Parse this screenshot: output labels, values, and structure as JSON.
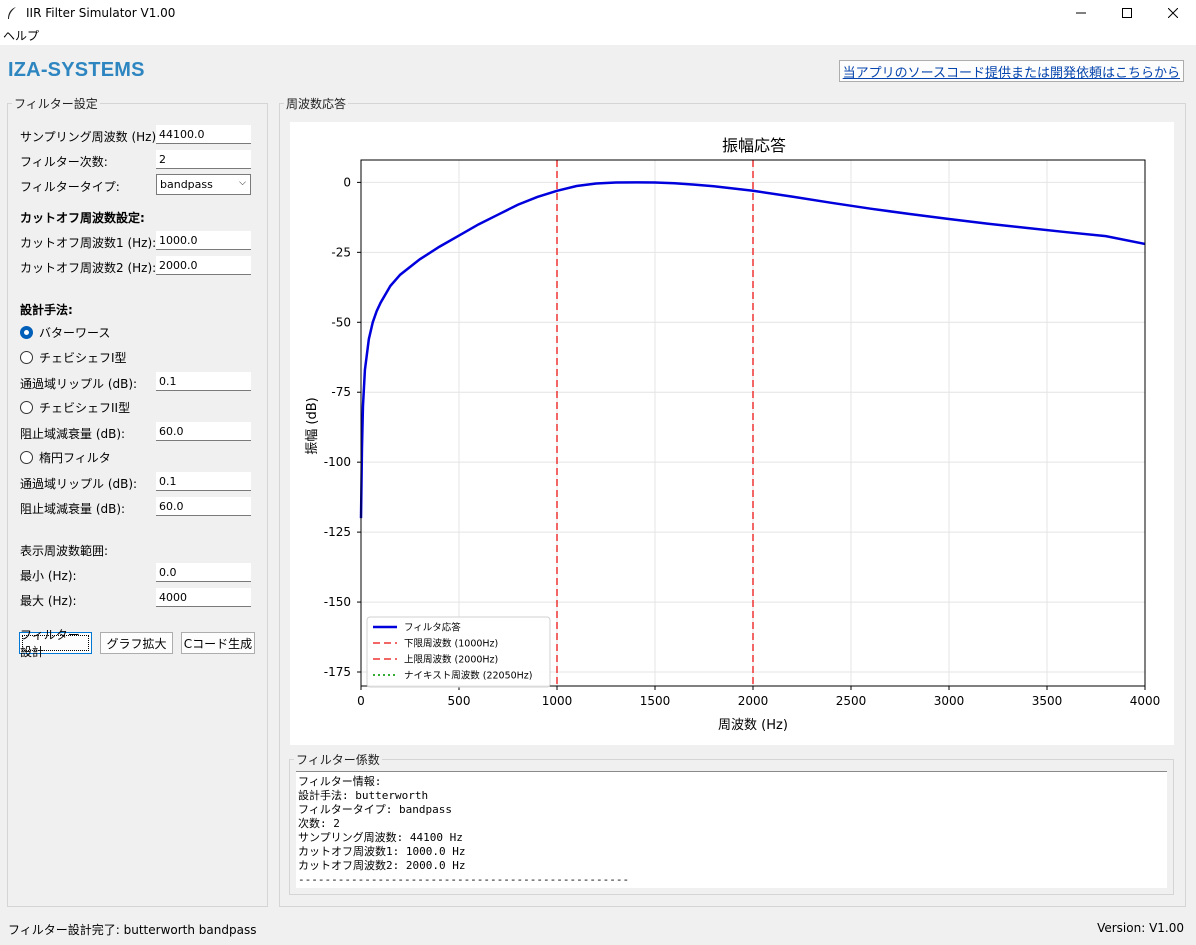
{
  "window": {
    "title": "IIR Filter Simulator V1.00",
    "menu_help": "ヘルプ"
  },
  "header": {
    "brand": "IZA-SYSTEMS",
    "link": "当アプリのソースコード提供または開発依頼はこちらから"
  },
  "settings": {
    "legend": "フィルター設定",
    "sampling_label": "サンプリング周波数 (Hz):",
    "sampling_value": "44100.0",
    "order_label": "フィルター次数:",
    "order_value": "2",
    "type_label": "フィルタータイプ:",
    "type_value": "bandpass",
    "cutoff_heading": "カットオフ周波数設定:",
    "cutoff1_label": "カットオフ周波数1 (Hz):",
    "cutoff1_value": "1000.0",
    "cutoff2_label": "カットオフ周波数2 (Hz):",
    "cutoff2_value": "2000.0",
    "design_heading": "設計手法:",
    "radio_butterworth": "バターワース",
    "radio_cheby1": "チェビシェフI型",
    "ripple1_label": "通過域リップル (dB):",
    "ripple1_value": "0.1",
    "radio_cheby2": "チェビシェフII型",
    "atten1_label": "阻止域減衰量 (dB):",
    "atten1_value": "60.0",
    "radio_elliptic": "楕円フィルタ",
    "ripple2_label": "通過域リップル (dB):",
    "ripple2_value": "0.1",
    "atten2_label": "阻止域減衰量 (dB):",
    "atten2_value": "60.0",
    "range_heading": "表示周波数範囲:",
    "min_label": "最小 (Hz):",
    "min_value": "0.0",
    "max_label": "最大 (Hz):",
    "max_value": "4000",
    "btn_design": "フィルター設計",
    "btn_zoom": "グラフ拡大",
    "btn_ccode": "Cコード生成"
  },
  "response": {
    "legend": "周波数応答"
  },
  "coefficients": {
    "legend": "フィルター係数",
    "lines": [
      "フィルター情報:",
      "設計手法: butterworth",
      "フィルタータイプ: bandpass",
      "次数: 2",
      "サンプリング周波数: 44100 Hz",
      "カットオフ周波数1: 1000.0 Hz",
      "カットオフ周波数2: 2000.0 Hz",
      "--------------------------------------------------"
    ]
  },
  "status": {
    "message": "フィルター設計完了: butterworth bandpass",
    "version": "Version: V1.00"
  },
  "colors": {
    "brand": "#2e86c1",
    "response_line": "#0000dd",
    "cutoff_line": "#ee3333",
    "nyquist_line": "#33aa33"
  },
  "chart_data": {
    "type": "line",
    "title": "振幅応答",
    "xlabel": "周波数 (Hz)",
    "ylabel": "振幅 (dB)",
    "xlim": [
      0,
      4000
    ],
    "ylim": [
      -180,
      8
    ],
    "xticks": [
      0,
      500,
      1000,
      1500,
      2000,
      2500,
      3000,
      3500,
      4000
    ],
    "yticks": [
      0,
      -25,
      -50,
      -75,
      -100,
      -125,
      -150,
      -175
    ],
    "grid": true,
    "legend_position": "lower-left",
    "series": [
      {
        "name": "フィルタ応答",
        "style": "solid",
        "x": [
          0,
          5,
          10,
          20,
          40,
          60,
          80,
          100,
          150,
          200,
          300,
          400,
          500,
          600,
          700,
          800,
          900,
          1000,
          1100,
          1200,
          1300,
          1414,
          1500,
          1600,
          1700,
          1800,
          1900,
          2000,
          2200,
          2400,
          2600,
          2800,
          3000,
          3200,
          3400,
          3600,
          3800,
          4000
        ],
        "y": [
          -120,
          -95,
          -80,
          -67,
          -56,
          -50,
          -46,
          -43,
          -37,
          -33,
          -27.5,
          -23,
          -19,
          -15,
          -11.5,
          -8,
          -5.2,
          -3,
          -1.3,
          -0.4,
          -0.05,
          0,
          -0.05,
          -0.3,
          -0.8,
          -1.4,
          -2.2,
          -3,
          -5.1,
          -7.3,
          -9.4,
          -11.3,
          -13.1,
          -14.8,
          -16.3,
          -17.8,
          -19.2,
          -22
        ]
      },
      {
        "name": "下限周波数 (1000Hz)",
        "style": "dashed",
        "vline": 1000
      },
      {
        "name": "上限周波数 (2000Hz)",
        "style": "dashed",
        "vline": 2000
      },
      {
        "name": "ナイキスト周波数 (22050Hz)",
        "style": "dotted",
        "vline": 22050
      }
    ]
  }
}
